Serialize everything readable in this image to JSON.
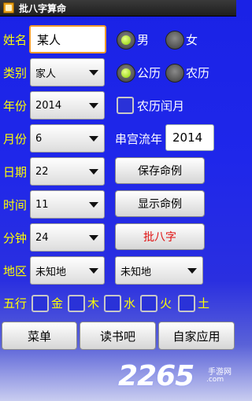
{
  "window": {
    "title": "批八字算命",
    "app_icon": "app-icon"
  },
  "form": {
    "name_label": "姓名",
    "name_value": "某人",
    "gender_male": "男",
    "gender_female": "女",
    "gender_selected": "男",
    "category_label": "类别",
    "category_value": "家人",
    "calendar_solar": "公历",
    "calendar_lunar": "农历",
    "calendar_selected": "公历",
    "year_label": "年份",
    "year_value": "2014",
    "leap_month_label": "农历闰月",
    "month_label": "月份",
    "month_value": "6",
    "flow_year_label": "串宫流年",
    "flow_year_value": "2014",
    "day_label": "日期",
    "day_value": "22",
    "hour_label": "时间",
    "hour_value": "11",
    "minute_label": "分钟",
    "minute_value": "24",
    "region_label": "地区",
    "region_value_1": "未知地",
    "region_value_2": "未知地"
  },
  "buttons": {
    "save": "保存命例",
    "show": "显示命例",
    "bazi": "批八字"
  },
  "wuxing": {
    "label": "五行",
    "items": [
      "金",
      "木",
      "水",
      "火",
      "土"
    ]
  },
  "bottom_bar": {
    "menu": "菜单",
    "read": "读书吧",
    "apps": "自家应用"
  },
  "watermark": {
    "number": "2265",
    "suffix": ".com",
    "sub": "手游网"
  },
  "colors": {
    "label": "#ffff00",
    "background": "#1f27ea",
    "accent_button": "#e01010",
    "focus": "#f39a2a"
  }
}
